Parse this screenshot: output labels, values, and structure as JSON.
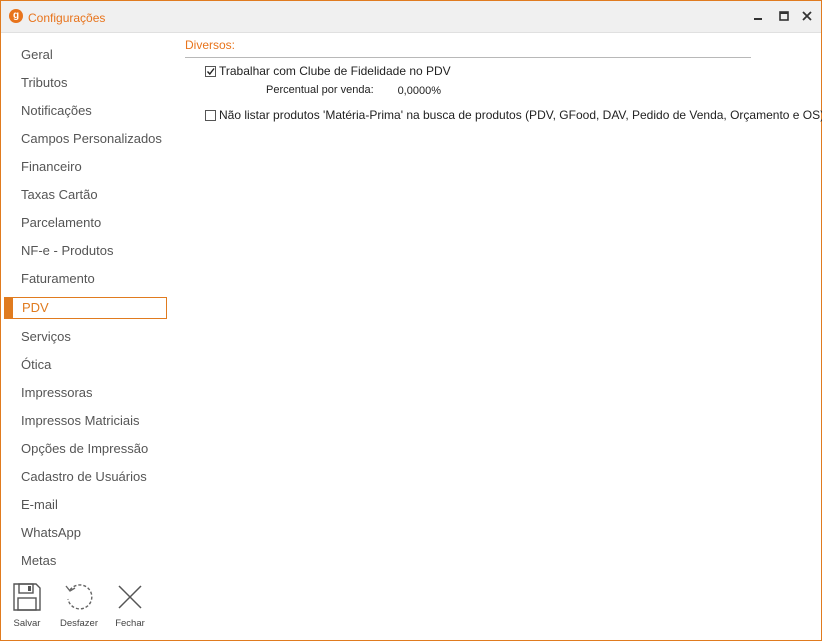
{
  "window": {
    "title": "Configurações",
    "app_icon_letter": "g",
    "accent_color": "#e8741c"
  },
  "sidebar": {
    "items": [
      {
        "label": "Geral"
      },
      {
        "label": "Tributos"
      },
      {
        "label": "Notificações"
      },
      {
        "label": "Campos Personalizados"
      },
      {
        "label": "Financeiro"
      },
      {
        "label": "Taxas Cartão"
      },
      {
        "label": "Parcelamento"
      },
      {
        "label": "NF-e - Produtos"
      },
      {
        "label": "Faturamento"
      },
      {
        "label": "PDV",
        "active": true
      },
      {
        "label": "Serviços"
      },
      {
        "label": "Ótica"
      },
      {
        "label": "Impressoras"
      },
      {
        "label": "Impressos Matriciais"
      },
      {
        "label": "Opções de Impressão"
      },
      {
        "label": "Cadastro de Usuários"
      },
      {
        "label": "E-mail"
      },
      {
        "label": "WhatsApp"
      },
      {
        "label": "Metas"
      }
    ]
  },
  "main": {
    "section_title": "Diversos:",
    "fidelidade": {
      "label": "Trabalhar com Clube de Fidelidade no PDV",
      "checked": true
    },
    "percentual": {
      "label": "Percentual por venda:",
      "value": "0,0000%"
    },
    "materia_prima": {
      "label": "Não listar produtos 'Matéria-Prima' na busca de produtos (PDV, GFood, DAV, Pedido de Venda, Orçamento e OS)",
      "checked": false
    }
  },
  "toolbar": {
    "save_label": "Salvar",
    "undo_label": "Desfazer",
    "close_label": "Fechar"
  }
}
